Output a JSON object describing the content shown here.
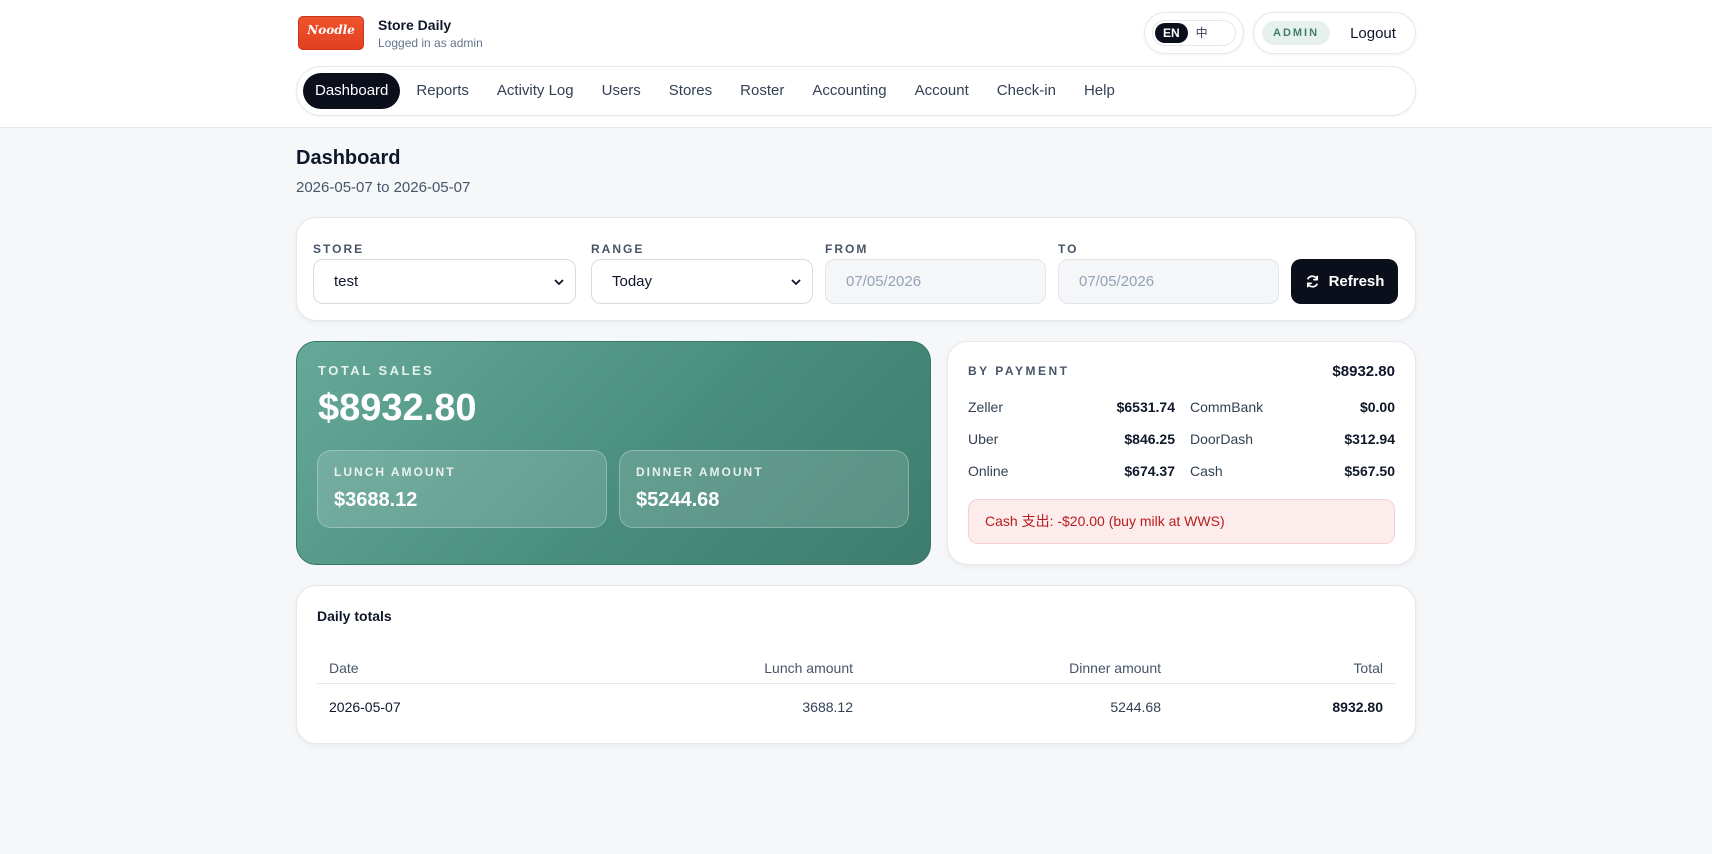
{
  "header": {
    "app_title": "Store Daily",
    "subtitle": "Logged in as admin",
    "logo_text": "Noodle",
    "lang_options": [
      "EN",
      "中"
    ],
    "lang_active": "EN",
    "role_badge": "ADMIN",
    "logout_label": "Logout"
  },
  "nav": {
    "items": [
      "Dashboard",
      "Reports",
      "Activity Log",
      "Users",
      "Stores",
      "Roster",
      "Accounting",
      "Account",
      "Check-in",
      "Help"
    ],
    "active": "Dashboard"
  },
  "page": {
    "title": "Dashboard",
    "range_text": "2026-05-07 to 2026-05-07"
  },
  "filters": {
    "store_label": "STORE",
    "store_value": "test",
    "range_label": "RANGE",
    "range_value": "Today",
    "from_label": "FROM",
    "from_value": "07/05/2026",
    "to_label": "TO",
    "to_value": "07/05/2026",
    "refresh_label": "Refresh"
  },
  "sales": {
    "label": "TOTAL SALES",
    "value": "$8932.80",
    "lunch_label": "LUNCH AMOUNT",
    "lunch_value": "$3688.12",
    "dinner_label": "DINNER AMOUNT",
    "dinner_value": "$5244.68"
  },
  "payment": {
    "label": "BY PAYMENT",
    "total": "$8932.80",
    "rows": [
      {
        "name": "Zeller",
        "value": "$6531.74"
      },
      {
        "name": "CommBank",
        "value": "$0.00"
      },
      {
        "name": "Uber",
        "value": "$846.25"
      },
      {
        "name": "DoorDash",
        "value": "$312.94"
      },
      {
        "name": "Online",
        "value": "$674.37"
      },
      {
        "name": "Cash",
        "value": "$567.50"
      }
    ],
    "cash_note": "Cash 支出: -$20.00 (buy milk at WWS)"
  },
  "daily": {
    "title": "Daily totals",
    "columns": [
      "Date",
      "Lunch amount",
      "Dinner amount",
      "Total"
    ],
    "rows": [
      [
        "2026-05-07",
        "3688.12",
        "5244.68",
        "8932.80"
      ]
    ]
  },
  "colors": {
    "accent_dark": "#0b0f1c",
    "sales_green": "#4a8e7e",
    "alert_red": "#b91c1c"
  }
}
